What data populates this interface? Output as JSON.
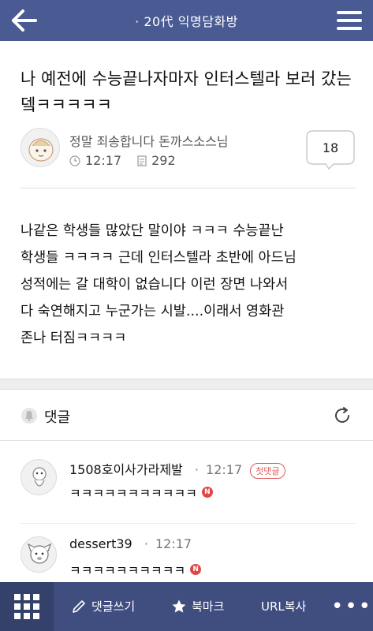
{
  "topbar": {
    "title": "· 20代 익명담화방",
    "back_icon": "arrow-left-icon",
    "menu_icon": "hamburger-menu-icon"
  },
  "post": {
    "title": "나 예전에 수능끝나자마자 인터스텔라 보러 갔는뎈ㅋㅋㅋㅋㅋ",
    "author": "정말 죄송합니다 돈까스소스님",
    "time": "12:17",
    "views": "292",
    "comment_count": "18",
    "body": "나같은 학생들 많았단 말이야 ㅋㅋㅋ 수능끝난\n학생들 ㅋㅋㅋㅋ 근데 인터스텔라 초반에 아드님\n성적에는 갈 대학이 없습니다 이런 장면 나와서\n다 숙연해지고 누군가는 시발....이래서 영화관\n존나 터짐ㅋㅋㅋㅋ"
  },
  "comments_section": {
    "label": "댓글",
    "items": [
      {
        "name": "1508호이사가라제발",
        "time": "12:17",
        "badge": "첫댓글",
        "text": "ㅋㅋㅋㅋㅋㅋㅋㅋㅋㅋㅋ"
      },
      {
        "name": "dessert39",
        "time": "12:17",
        "text": "ㅋㅋㅋㅋㅋㅋㅋㅋㅋㅋ"
      }
    ],
    "new_badge": "N"
  },
  "bottombar": {
    "write_comment": "댓글쓰기",
    "bookmark": "북마크",
    "copy_url": "URL복사",
    "more": "•••"
  },
  "colors": {
    "topbar": "#4a5a93",
    "bottombar": "#3f4d7f",
    "accent_red": "#e04848"
  }
}
